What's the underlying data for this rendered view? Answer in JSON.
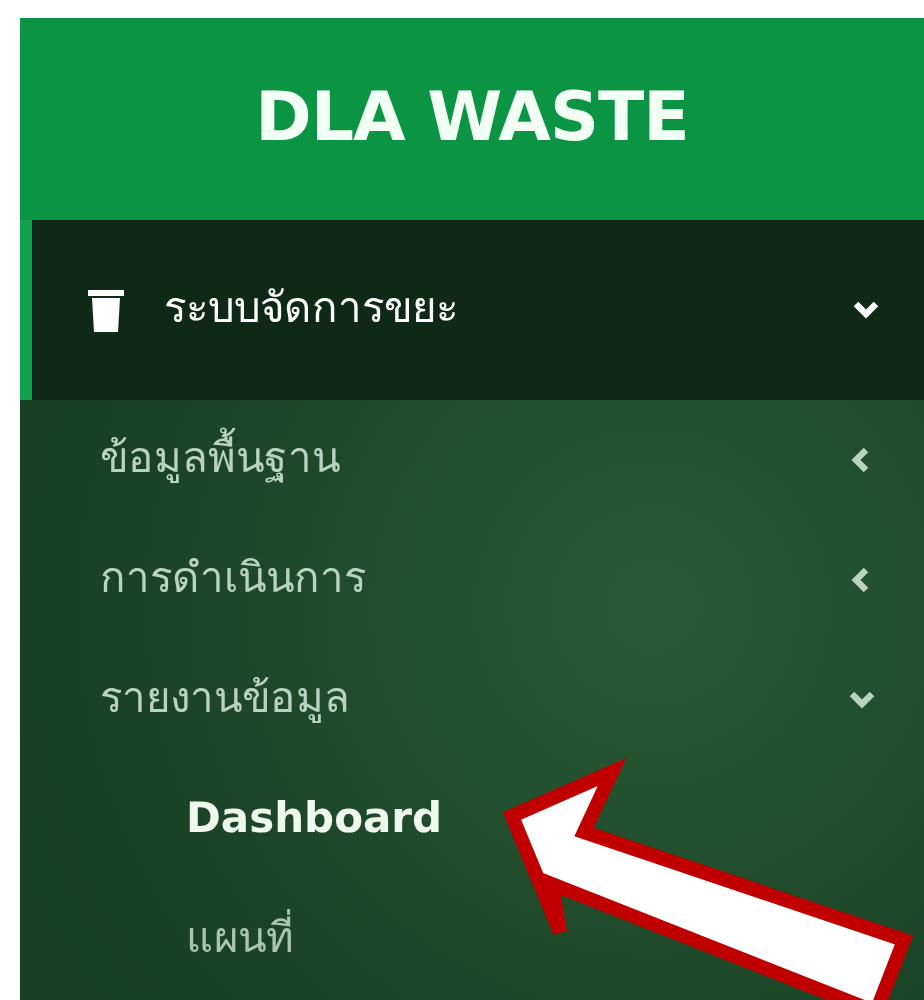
{
  "brand": "DLA WASTE",
  "menu": [
    {
      "label": "ระบบจัดการขยะ",
      "expanded": true,
      "selected": true,
      "children": [
        {
          "label": "ข้อมูลพื้นฐาน",
          "expanded": false,
          "selected": false
        },
        {
          "label": "การดำเนินการ",
          "expanded": false,
          "selected": false
        },
        {
          "label": "รายงานข้อมูล",
          "expanded": true,
          "selected": false,
          "children": [
            {
              "label": "Dashboard",
              "selected": true
            },
            {
              "label": "แผนที่",
              "selected": false
            }
          ]
        }
      ]
    }
  ]
}
